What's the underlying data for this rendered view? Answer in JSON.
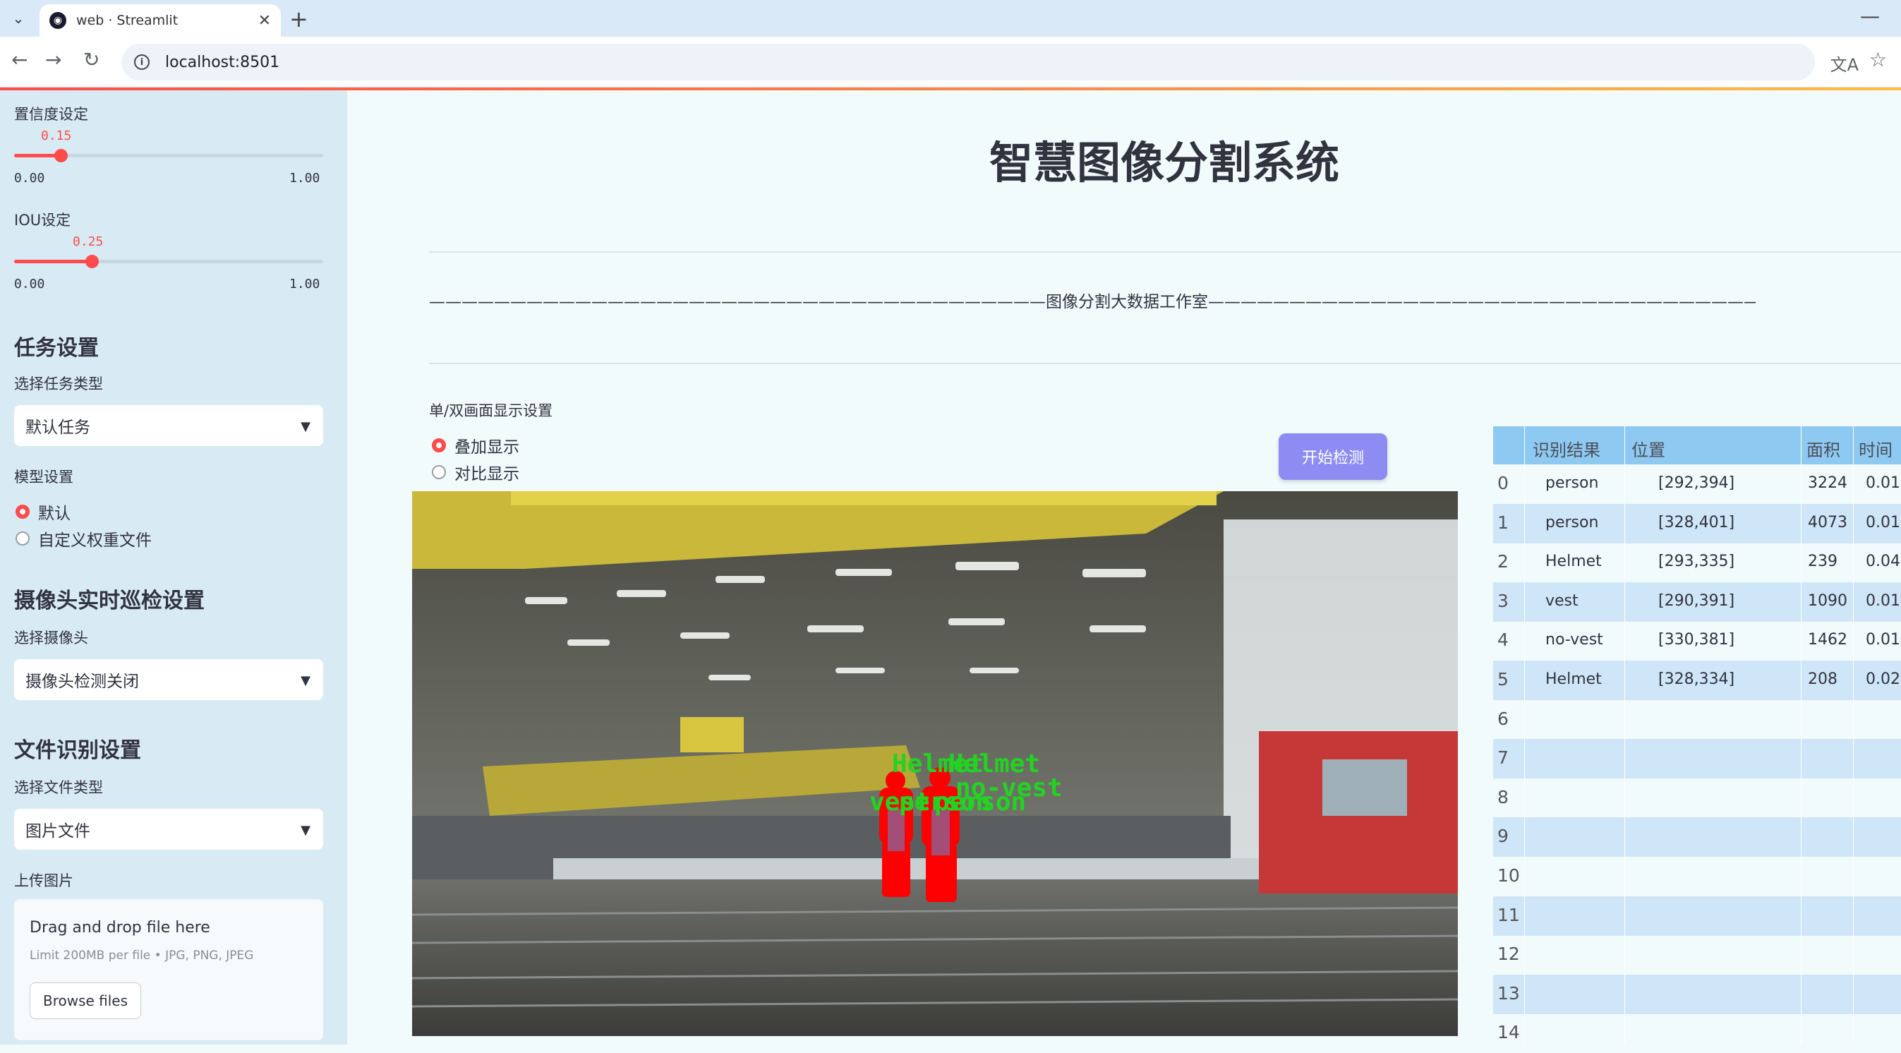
{
  "browser": {
    "tab_title": "web · Streamlit",
    "url": "localhost:8501"
  },
  "sidebar": {
    "confidence": {
      "label": "置信度设定",
      "value": "0.15",
      "value_fraction": 0.15,
      "min": "0.00",
      "max": "1.00"
    },
    "iou": {
      "label": "IOU设定",
      "value": "0.25",
      "value_fraction": 0.25,
      "min": "0.00",
      "max": "1.00"
    },
    "task": {
      "heading": "任务设置",
      "select_label": "选择任务类型",
      "selected": "默认任务"
    },
    "model": {
      "label": "模型设置",
      "options": [
        "默认",
        "自定义权重文件"
      ],
      "selected_index": 0
    },
    "camera": {
      "heading": "摄像头实时巡检设置",
      "select_label": "选择摄像头",
      "selected": "摄像头检测关闭"
    },
    "file": {
      "heading": "文件识别设置",
      "select_label": "选择文件类型",
      "selected": "图片文件"
    },
    "upload": {
      "label": "上传图片",
      "title": "Drag and drop file here",
      "limit": "Limit 200MB per file • JPG, PNG, JPEG",
      "button": "Browse files"
    }
  },
  "main": {
    "title": "智慧图像分割系统",
    "studio_line": "——————————————————————————————————————图像分割大数据工作室——————————————————————————————————————",
    "display": {
      "label": "单/双画面显示设置",
      "options": [
        "叠加显示",
        "对比显示"
      ],
      "selected_index": 0
    },
    "start_button": "开始检测",
    "overlay_labels": [
      "Helmet",
      "Helmet",
      "no-vest",
      "vest",
      "person",
      "person"
    ]
  },
  "table": {
    "headers": [
      "识别结果",
      "位置",
      "面积",
      "时间"
    ],
    "rows": [
      {
        "idx": "0",
        "label": "person",
        "pos": "[292,394]",
        "area": "3224",
        "time": "0.01"
      },
      {
        "idx": "1",
        "label": "person",
        "pos": "[328,401]",
        "area": "4073",
        "time": "0.01"
      },
      {
        "idx": "2",
        "label": "Helmet",
        "pos": "[293,335]",
        "area": "239",
        "time": "0.04"
      },
      {
        "idx": "3",
        "label": "vest",
        "pos": "[290,391]",
        "area": "1090",
        "time": "0.01"
      },
      {
        "idx": "4",
        "label": "no-vest",
        "pos": "[330,381]",
        "area": "1462",
        "time": "0.01"
      },
      {
        "idx": "5",
        "label": "Helmet",
        "pos": "[328,334]",
        "area": "208",
        "time": "0.02"
      },
      {
        "idx": "6",
        "label": "",
        "pos": "",
        "area": "",
        "time": ""
      },
      {
        "idx": "7",
        "label": "",
        "pos": "",
        "area": "",
        "time": ""
      },
      {
        "idx": "8",
        "label": "",
        "pos": "",
        "area": "",
        "time": ""
      },
      {
        "idx": "9",
        "label": "",
        "pos": "",
        "area": "",
        "time": ""
      },
      {
        "idx": "10",
        "label": "",
        "pos": "",
        "area": "",
        "time": ""
      },
      {
        "idx": "11",
        "label": "",
        "pos": "",
        "area": "",
        "time": ""
      },
      {
        "idx": "12",
        "label": "",
        "pos": "",
        "area": "",
        "time": ""
      },
      {
        "idx": "13",
        "label": "",
        "pos": "",
        "area": "",
        "time": ""
      },
      {
        "idx": "14",
        "label": "",
        "pos": "",
        "area": "",
        "time": ""
      }
    ]
  },
  "colors": {
    "accent": "#ff4b4b",
    "button": "#8c8cf2",
    "table_header": "#8ec9f2",
    "detection_text": "#22d322",
    "mask": "#ff0000"
  }
}
